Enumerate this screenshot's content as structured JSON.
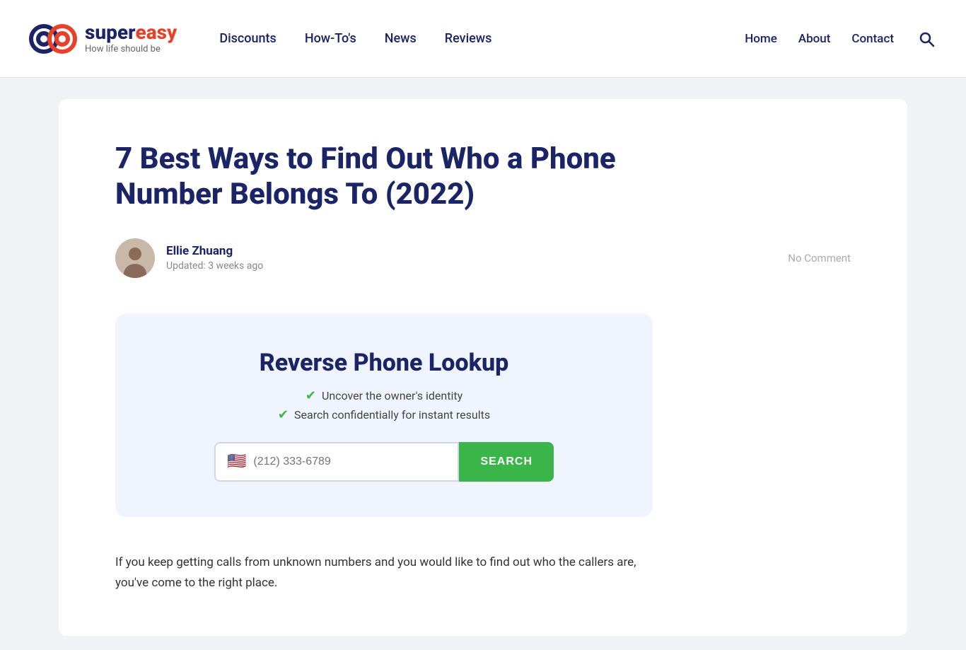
{
  "header": {
    "logo": {
      "super": "super",
      "easy": "easy",
      "tagline": "How life should be"
    },
    "nav_left": [
      {
        "label": "Discounts",
        "id": "discounts"
      },
      {
        "label": "How-To's",
        "id": "howtos"
      },
      {
        "label": "News",
        "id": "news"
      },
      {
        "label": "Reviews",
        "id": "reviews"
      }
    ],
    "nav_right": [
      {
        "label": "Home",
        "id": "home"
      },
      {
        "label": "About",
        "id": "about"
      },
      {
        "label": "Contact",
        "id": "contact"
      }
    ]
  },
  "article": {
    "title": "7 Best Ways to Find Out Who a Phone Number Belongs To (2022)",
    "author": {
      "name": "Ellie Zhuang",
      "updated": "Updated: 3 weeks ago"
    },
    "no_comment": "No Comment",
    "lookup_widget": {
      "title": "Reverse Phone Lookup",
      "features": [
        "Uncover the owner's identity",
        "Search confidentially for instant results"
      ],
      "input_placeholder": "(212) 333-6789",
      "search_label": "SEARCH"
    },
    "body_text": "If you keep getting calls from unknown numbers and you would like to find out who the callers are, you've come to the right place."
  }
}
